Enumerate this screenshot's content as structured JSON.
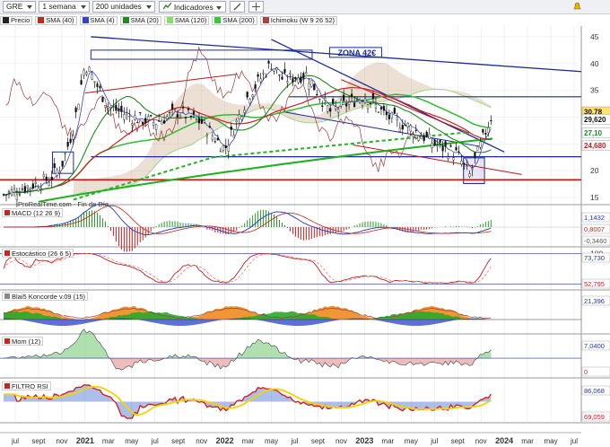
{
  "toolbar": {
    "symbol": "GRE",
    "period": "1 semana",
    "units": "200 unidades",
    "indicators": "Indicadores"
  },
  "legend": [
    {
      "label": "Precio",
      "color": "#222222"
    },
    {
      "label": "SMA (40)",
      "color": "#cc2222"
    },
    {
      "label": "SMA (4)",
      "color": "#3344cc"
    },
    {
      "label": "SMA (20)",
      "color": "#228822"
    },
    {
      "label": "SMA (120)",
      "color": "#88dd66"
    },
    {
      "label": "SMA (200)",
      "color": "#33cc33"
    },
    {
      "label": "Ichimoku (W 9 26 52)",
      "color": "#aa4444"
    }
  ],
  "source_note": "ProRealTime.com - Fin de Día",
  "annotation_zone": "ZONA 42€",
  "x_axis_labels": [
    "jul",
    "sept",
    "nov",
    "2021",
    "mar",
    "may",
    "jul",
    "sept",
    "nov",
    "2022",
    "mar",
    "may",
    "jul",
    "sept",
    "nov",
    "2023",
    "mar",
    "may",
    "jul",
    "sept",
    "nov",
    "2024",
    "mar",
    "may",
    "jul"
  ],
  "main_axis": {
    "ticks": [
      "45",
      "40",
      "35",
      "30",
      "25",
      "20",
      "15"
    ],
    "badges": [
      {
        "text": "30,78",
        "bg": "#ffe36a",
        "fg": "#111"
      },
      {
        "text": "29,620",
        "bg": "#ffffff",
        "fg": "#111"
      },
      {
        "text": "27,10",
        "bg": "#ffffff",
        "fg": "#1b8c1b"
      },
      {
        "text": "24,680",
        "bg": "#ffffff",
        "fg": "#c02020"
      }
    ]
  },
  "panels": [
    {
      "id": "macd",
      "label": "MACD (12 26 9)",
      "color": "#cc2222",
      "badges": [
        "1,1432",
        "0,8007",
        "-0,3460"
      ],
      "ticks": []
    },
    {
      "id": "stoch",
      "label": "Estocástico (26 6 5)",
      "color": "#cc2222",
      "badges": [
        "73,730",
        "52,795"
      ],
      "ticks": [
        "100",
        "0"
      ]
    },
    {
      "id": "blai5",
      "label": "Blai5 Koncorde v.09 (15)",
      "color": "#888888",
      "badges": [
        "21,396"
      ],
      "ticks": []
    },
    {
      "id": "mom",
      "label": "Mom (12)",
      "color": "#cc2222",
      "badges": [
        "7,0400",
        "0"
      ],
      "ticks": []
    },
    {
      "id": "rsi",
      "label": "FILTRO RSI",
      "color": "#cc2222",
      "badges": [
        "86,068",
        "69,059"
      ],
      "ticks": []
    }
  ],
  "chart_data": {
    "type": "candlestick",
    "x_start": "2020-06",
    "x_end": "2024-07",
    "ylim": [
      14,
      47
    ],
    "price_weekly_approx": [
      {
        "date": "2020-06",
        "close": 15.5
      },
      {
        "date": "2020-08",
        "close": 17
      },
      {
        "date": "2020-10",
        "close": 18.5
      },
      {
        "date": "2020-11",
        "close": 21
      },
      {
        "date": "2020-12",
        "close": 28
      },
      {
        "date": "2021-01",
        "close": 40
      },
      {
        "date": "2021-02",
        "close": 36
      },
      {
        "date": "2021-03",
        "close": 32
      },
      {
        "date": "2021-05",
        "close": 30
      },
      {
        "date": "2021-07",
        "close": 29
      },
      {
        "date": "2021-09",
        "close": 31
      },
      {
        "date": "2021-11",
        "close": 29
      },
      {
        "date": "2022-01",
        "close": 24
      },
      {
        "date": "2022-03",
        "close": 34
      },
      {
        "date": "2022-05",
        "close": 40
      },
      {
        "date": "2022-06",
        "close": 37
      },
      {
        "date": "2022-08",
        "close": 38
      },
      {
        "date": "2022-10",
        "close": 31
      },
      {
        "date": "2023-01",
        "close": 34
      },
      {
        "date": "2023-03",
        "close": 30
      },
      {
        "date": "2023-05",
        "close": 28
      },
      {
        "date": "2023-07",
        "close": 25
      },
      {
        "date": "2023-09",
        "close": 23
      },
      {
        "date": "2023-10",
        "close": 19
      },
      {
        "date": "2023-11",
        "close": 25
      },
      {
        "date": "2023-12",
        "close": 30.78
      }
    ],
    "horizontal_levels": [
      42,
      33.8,
      22.6,
      18.3
    ],
    "last_close": 30.78
  }
}
